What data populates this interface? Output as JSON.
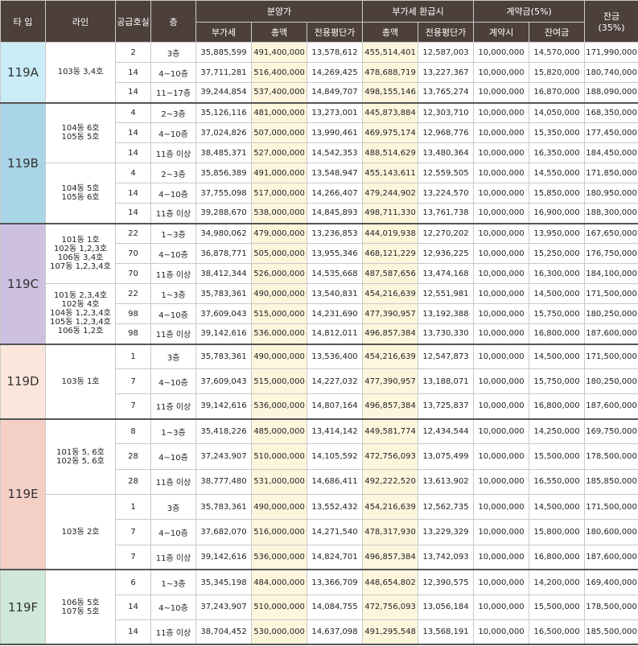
{
  "header": {
    "type": "타 입",
    "line": "라인",
    "supply": "공급호실",
    "floor": "층",
    "sale": "분양가",
    "vat_refund": "부가세 환급시",
    "contract": "계약금(5%)",
    "balance": "잔금",
    "balance_pct": "(35%)",
    "vat": "부가세",
    "total": "총액",
    "per_pyeong": "전용평단가",
    "refund_total": "총액",
    "refund_per_pyeong": "전용평단가",
    "contract_at": "계약시",
    "remaining": "잔여금"
  },
  "colors": {
    "A": "#c9ecf6",
    "B": "#a9d5e6",
    "C": "#cdc0e0",
    "D": "#fbe6dc",
    "E": "#f3cfc6",
    "F": "#cfe8d9"
  },
  "groups": [
    {
      "type": "119A",
      "color": "A",
      "height": 75,
      "lines": [
        {
          "label": "103동 3,4호",
          "rows": [
            [
              "2",
              "3층",
              "35,885,599",
              "491,400,000",
              "13,578,612",
              "455,514,401",
              "12,587,003",
              "10,000,000",
              "14,570,000",
              "171,990,000"
            ],
            [
              "14",
              "4~10층",
              "37,711,281",
              "516,400,000",
              "14,269,425",
              "478,688,719",
              "13,227,367",
              "10,000,000",
              "15,820,000",
              "180,740,000"
            ],
            [
              "14",
              "11~17층",
              "39,244,854",
              "537,400,000",
              "14,849,707",
              "498,155,146",
              "13,765,274",
              "10,000,000",
              "16,870,000",
              "188,090,000"
            ]
          ]
        }
      ]
    },
    {
      "type": "119B",
      "color": "B",
      "height": 150,
      "lines": [
        {
          "label": "104동 6호\n105동 5호",
          "rows": [
            [
              "4",
              "2~3층",
              "35,126,116",
              "481,000,000",
              "13,273,001",
              "445,873,884",
              "12,303,710",
              "10,000,000",
              "14,050,000",
              "168,350,000"
            ],
            [
              "14",
              "4~10층",
              "37,024,826",
              "507,000,000",
              "13,990,461",
              "469,975,174",
              "12,968,776",
              "10,000,000",
              "15,350,000",
              "177,450,000"
            ],
            [
              "14",
              "11층 이상",
              "38,485,371",
              "527,000,000",
              "14,542,353",
              "488,514,629",
              "13,480,364",
              "10,000,000",
              "16,350,000",
              "184,450,000"
            ]
          ]
        },
        {
          "label": "104동 5호\n105동 6호",
          "rows": [
            [
              "4",
              "2~3층",
              "35,856,389",
              "491,000,000",
              "13,548,947",
              "455,143,611",
              "12,559,505",
              "10,000,000",
              "14,550,000",
              "171,850,000"
            ],
            [
              "14",
              "4~10층",
              "37,755,098",
              "517,000,000",
              "14,266,407",
              "479,244,902",
              "13,224,570",
              "10,000,000",
              "15,850,000",
              "180,950,000"
            ],
            [
              "14",
              "11층 이상",
              "39,288,670",
              "538,000,000",
              "14,845,893",
              "498,711,330",
              "13,761,738",
              "10,000,000",
              "16,900,000",
              "188,300,000"
            ]
          ]
        }
      ]
    },
    {
      "type": "119C",
      "color": "C",
      "height": 150,
      "lines": [
        {
          "label": "101동 1호\n102동 1,2,3호\n106동 3,4호\n107동 1,2,3,4호",
          "rows": [
            [
              "22",
              "1~3층",
              "34,980,062",
              "479,000,000",
              "13,236,853",
              "444,019,938",
              "12,270,202",
              "10,000,000",
              "13,950,000",
              "167,650,000"
            ],
            [
              "70",
              "4~10층",
              "36,878,771",
              "505,000,000",
              "13,955,346",
              "468,121,229",
              "12,936,225",
              "10,000,000",
              "15,250,000",
              "176,750,000"
            ],
            [
              "70",
              "11층 이상",
              "38,412,344",
              "526,000,000",
              "14,535,668",
              "487,587,656",
              "13,474,168",
              "10,000,000",
              "16,300,000",
              "184,100,000"
            ]
          ]
        },
        {
          "label": "101동 2,3,4호\n102동 4호\n104동 1,2,3,4호\n105동 1,2,3,4호\n106동 1,2호",
          "rows": [
            [
              "22",
              "1~3층",
              "35,783,361",
              "490,000,000",
              "13,540,831",
              "454,216,639",
              "12,551,981",
              "10,000,000",
              "14,500,000",
              "171,500,000"
            ],
            [
              "98",
              "4~10층",
              "37,609,043",
              "515,000,000",
              "14,231,690",
              "477,390,957",
              "13,192,388",
              "10,000,000",
              "15,750,000",
              "180,250,000"
            ],
            [
              "98",
              "11층 이상",
              "39,142,616",
              "536,000,000",
              "14,812,011",
              "496,857,384",
              "13,730,330",
              "10,000,000",
              "16,800,000",
              "187,600,000"
            ]
          ]
        }
      ]
    },
    {
      "type": "119D",
      "color": "D",
      "height": 93,
      "lines": [
        {
          "label": "103동 1호",
          "rows": [
            [
              "1",
              "3층",
              "35,783,361",
              "490,000,000",
              "13,536,400",
              "454,216,639",
              "12,547,873",
              "10,000,000",
              "14,500,000",
              "171,500,000"
            ],
            [
              "7",
              "4~10층",
              "37,609,043",
              "515,000,000",
              "14,227,032",
              "477,390,957",
              "13,188,071",
              "10,000,000",
              "15,750,000",
              "180,250,000"
            ],
            [
              "7",
              "11층 이상",
              "39,142,616",
              "536,000,000",
              "14,807,164",
              "496,857,384",
              "13,725,837",
              "10,000,000",
              "16,800,000",
              "187,600,000"
            ]
          ]
        }
      ]
    },
    {
      "type": "119E",
      "color": "E",
      "height": 188,
      "lines": [
        {
          "label": "101동 5, 6호\n102동 5, 6호",
          "rows": [
            [
              "8",
              "1~3층",
              "35,418,226",
              "485,000,000",
              "13,414,142",
              "449,581,774",
              "12,434,544",
              "10,000,000",
              "14,250,000",
              "169,750,000"
            ],
            [
              "28",
              "4~10층",
              "37,243,907",
              "510,000,000",
              "14,105,592",
              "472,756,093",
              "13,075,499",
              "10,000,000",
              "15,500,000",
              "178,500,000"
            ],
            [
              "28",
              "11층 이상",
              "38,777,480",
              "531,000,000",
              "14,686,411",
              "492,222,520",
              "13,613,902",
              "10,000,000",
              "16,550,000",
              "185,850,000"
            ]
          ]
        },
        {
          "label": "103동 2호",
          "rows": [
            [
              "1",
              "3층",
              "35,783,361",
              "490,000,000",
              "13,552,432",
              "454,216,639",
              "12,562,735",
              "10,000,000",
              "14,500,000",
              "171,500,000"
            ],
            [
              "7",
              "4~10층",
              "37,682,070",
              "516,000,000",
              "14,271,540",
              "478,317,930",
              "13,229,329",
              "10,000,000",
              "15,800,000",
              "180,600,000"
            ],
            [
              "7",
              "11층 이상",
              "39,142,616",
              "536,000,000",
              "14,824,701",
              "496,857,384",
              "13,742,093",
              "10,000,000",
              "16,800,000",
              "187,600,000"
            ]
          ]
        }
      ]
    },
    {
      "type": "119F",
      "color": "F",
      "height": 93,
      "lines": [
        {
          "label": "106동 5호\n107동 5호",
          "rows": [
            [
              "6",
              "1~3층",
              "35,345,198",
              "484,000,000",
              "13,366,709",
              "448,654,802",
              "12,390,575",
              "10,000,000",
              "14,200,000",
              "169,400,000"
            ],
            [
              "14",
              "4~10층",
              "37,243,907",
              "510,000,000",
              "14,084,755",
              "472,756,093",
              "13,056,184",
              "10,000,000",
              "15,500,000",
              "178,500,000"
            ],
            [
              "14",
              "11층 이상",
              "38,704,452",
              "530,000,000",
              "14,637,098",
              "491,295,548",
              "13,568,191",
              "10,000,000",
              "16,500,000",
              "185,500,000"
            ]
          ]
        }
      ]
    }
  ]
}
